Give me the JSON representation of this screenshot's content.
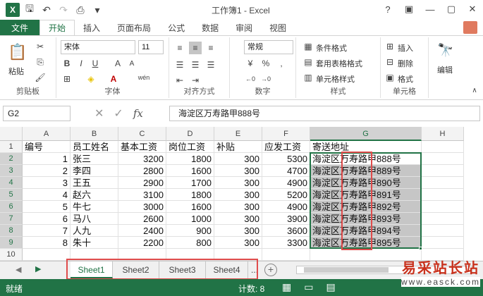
{
  "title_bar": {
    "title": "工作簿1 - Excel",
    "icons": [
      "excel-logo",
      "save-icon",
      "undo-icon",
      "redo-icon",
      "print-preview-icon",
      "customize-icon"
    ],
    "window_buttons": [
      "?",
      "▣",
      "—",
      "▢",
      "✕"
    ]
  },
  "tabs": [
    "文件",
    "开始",
    "插入",
    "页面布局",
    "公式",
    "数据",
    "审阅",
    "视图"
  ],
  "active_tab": "开始",
  "ribbon": {
    "clipboard": {
      "paste": "粘贴",
      "label": "剪贴板"
    },
    "font": {
      "name": "宋体",
      "size": "11",
      "bold": "B",
      "italic": "I",
      "underline": "U",
      "grow": "A",
      "shrink": "A",
      "wen": "wén",
      "label": "字体"
    },
    "alignment": {
      "label": "对齐方式"
    },
    "number": {
      "format": "常规",
      "pct": "%",
      "comma": ",",
      "label": "数字"
    },
    "styles": {
      "cond": "条件格式",
      "table": "套用表格格式",
      "cell": "单元格样式",
      "label": "样式"
    },
    "cells": {
      "insert": "插入",
      "delete": "删除",
      "format": "格式",
      "label": "单元格"
    },
    "editing": {
      "label": "编辑"
    }
  },
  "formula_bar": {
    "name_box": "G2",
    "cancel": "✕",
    "enter": "✓",
    "fx": "fx",
    "content": "海淀区万寿路甲888号"
  },
  "columns": [
    "A",
    "B",
    "C",
    "D",
    "E",
    "F",
    "G",
    "H"
  ],
  "rows": [
    "1",
    "2",
    "3",
    "4",
    "5",
    "6",
    "7",
    "8",
    "9",
    "10"
  ],
  "headers": [
    "编号",
    "员工姓名",
    "基本工资",
    "岗位工资",
    "补贴",
    "应发工资",
    "寄送地址"
  ],
  "data": [
    [
      "1",
      "张三",
      "3200",
      "1800",
      "300",
      "5300",
      "海淀区万寿路甲888号"
    ],
    [
      "2",
      "李四",
      "2800",
      "1600",
      "300",
      "4700",
      "海淀区万寿路甲889号"
    ],
    [
      "3",
      "王五",
      "2900",
      "1700",
      "300",
      "4900",
      "海淀区万寿路甲890号"
    ],
    [
      "4",
      "赵六",
      "3100",
      "1800",
      "300",
      "5200",
      "海淀区万寿路甲891号"
    ],
    [
      "5",
      "牛七",
      "3000",
      "1600",
      "300",
      "4900",
      "海淀区万寿路甲892号"
    ],
    [
      "6",
      "马八",
      "2600",
      "1000",
      "300",
      "3900",
      "海淀区万寿路甲893号"
    ],
    [
      "7",
      "人九",
      "2400",
      "900",
      "300",
      "3600",
      "海淀区万寿路甲894号"
    ],
    [
      "8",
      "朱十",
      "2200",
      "800",
      "300",
      "3300",
      "海淀区万寿路甲895号"
    ]
  ],
  "sheets": [
    "Sheet1",
    "Sheet2",
    "Sheet3",
    "Sheet4"
  ],
  "sheet_more": "...",
  "active_sheet": "Sheet1",
  "status": {
    "ready": "就绪",
    "count": "计数: 8"
  },
  "watermark": {
    "cn": "易采站长站",
    "url": "www.easck.com"
  },
  "colors": {
    "accent": "#217346",
    "highlight": "#e04c4c"
  }
}
